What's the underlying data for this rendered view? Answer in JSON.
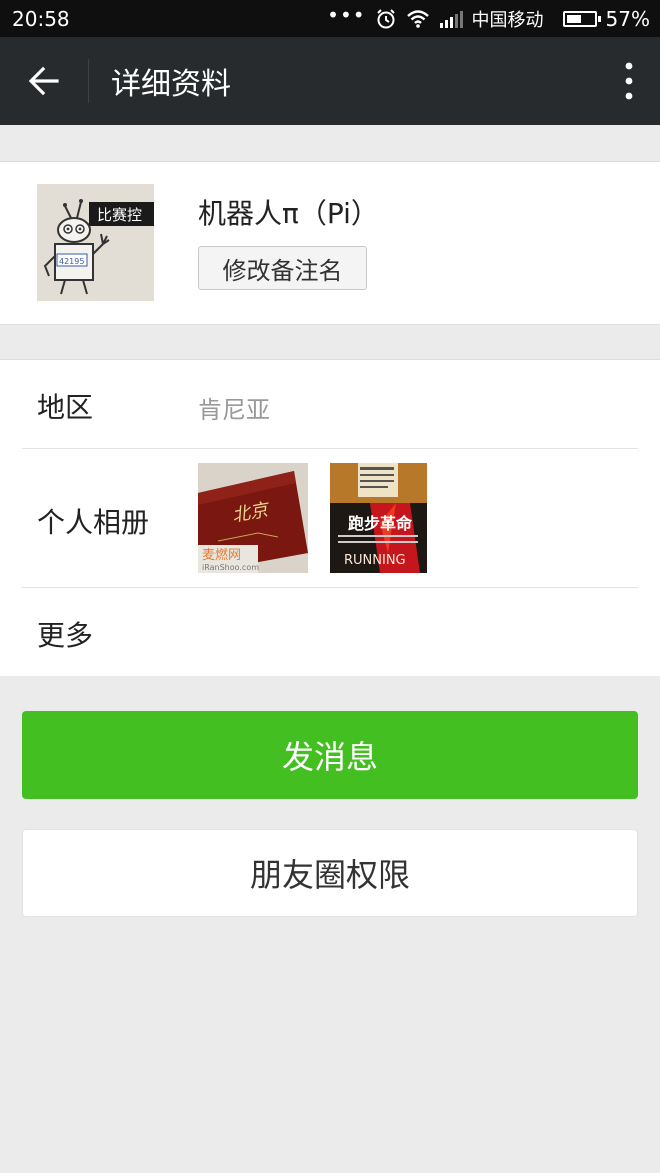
{
  "status_bar": {
    "time": "20:58",
    "dots": "•••",
    "carrier": "中国移动",
    "battery_percent": "57%",
    "battery_level": 0.57,
    "icons": [
      "alarm-icon",
      "wifi-icon",
      "signal-icon",
      "battery-icon"
    ]
  },
  "top_bar": {
    "title": "详细资料",
    "back_icon": "back-arrow-icon",
    "more_icon": "more-vertical-icon"
  },
  "profile": {
    "name": "机器人π（Pi）",
    "remark_button": "修改备注名",
    "avatar_text": "比赛控"
  },
  "info": {
    "region_label": "地区",
    "region_value": "肯尼亚",
    "album_label": "个人相册",
    "album_photos": [
      {
        "name": "photo-postcard-beijing",
        "text": "北京"
      },
      {
        "name": "photo-book-running",
        "text": "跑步革命",
        "sub": "RUNNING"
      }
    ],
    "more_label": "更多"
  },
  "actions": {
    "send_message": "发消息",
    "moments_permission": "朋友圈权限"
  },
  "colors": {
    "primary_green": "#44bf22",
    "topbar": "#272b2e",
    "background": "#ebebeb"
  }
}
